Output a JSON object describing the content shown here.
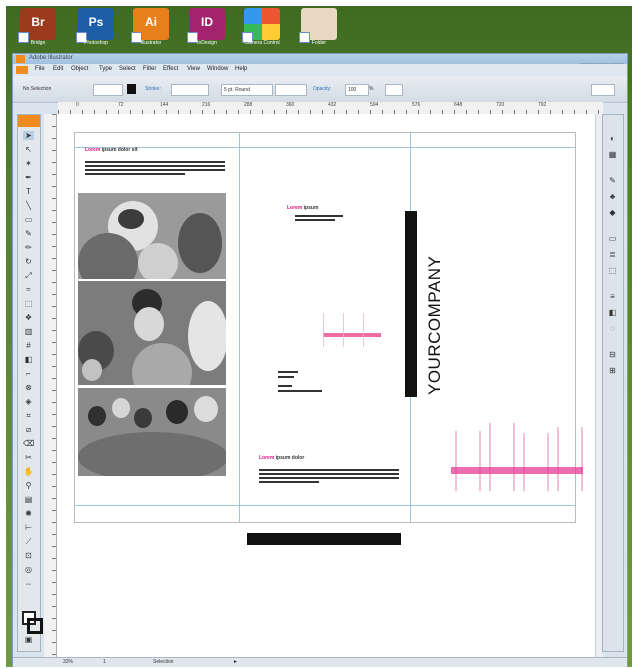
{
  "desktop": {
    "icons": [
      {
        "glyph": "Br",
        "label": "Bridge",
        "color": "#9b3b1c"
      },
      {
        "glyph": "Ps",
        "label": "Photoshop",
        "color": "#1d5ea9"
      },
      {
        "glyph": "Ai",
        "label": "Illustrator",
        "color": "#e8801a"
      },
      {
        "glyph": "ID",
        "label": "InDesign",
        "color": "#a3236d"
      },
      {
        "glyph": "",
        "label": "Camera Control",
        "color": "#4f8f2f"
      },
      {
        "glyph": "",
        "label": "Folder",
        "color": "#ead9c2"
      }
    ]
  },
  "window": {
    "title": "Adobe Illustrator",
    "controls": [
      "_",
      "□",
      "×"
    ]
  },
  "menu": [
    "File",
    "Edit",
    "Object",
    "Type",
    "Select",
    "Filter",
    "Effect",
    "View",
    "Window",
    "Help"
  ],
  "control_bar": {
    "selection": "No Selection",
    "stroke_label": "Stroke:",
    "brush": "5 pt. Round",
    "opacity_label": "Opacity:",
    "opacity": "100",
    "unit": "%"
  },
  "ruler_numbers": [
    "0",
    "72",
    "144",
    "216",
    "288",
    "360",
    "432",
    "504",
    "576",
    "648",
    "720",
    "792"
  ],
  "document": {
    "left_heading": {
      "pink": "Lorem",
      "rest": "ipsum dolor sit"
    },
    "center_heading": {
      "pink": "Lorem",
      "rest": "ipsum"
    },
    "bottom_heading": {
      "pink": "Lorem",
      "rest": "ipsum dolor"
    },
    "company": "YOURCOMPANY"
  },
  "status": {
    "zoom": "33%",
    "page": "1",
    "tool": "Selection"
  }
}
